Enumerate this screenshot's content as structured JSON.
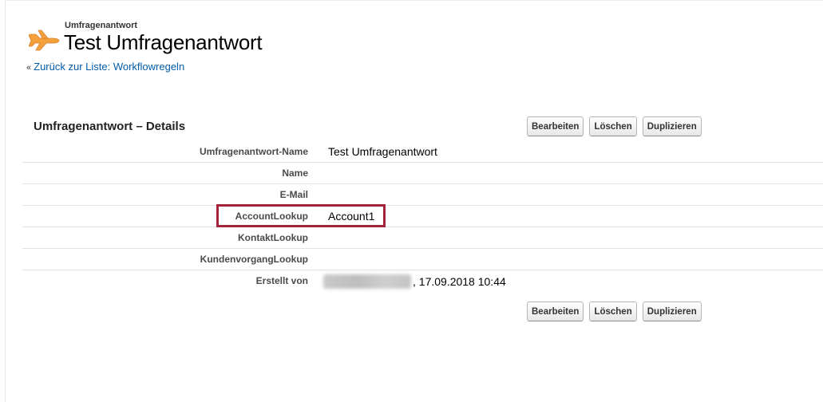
{
  "header": {
    "object_type": "Umfragenantwort",
    "title": "Test Umfragenantwort",
    "icon": "airplane-icon",
    "icon_color": "#f3a03d"
  },
  "back_link": {
    "arrow": "«",
    "label": "Zurück zur Liste: Workflowregeln",
    "color": "#015ba7"
  },
  "section": {
    "title": "Umfragenantwort – Details"
  },
  "buttons": {
    "edit": "Bearbeiten",
    "delete": "Löschen",
    "clone": "Duplizieren"
  },
  "fields": [
    {
      "label": "Umfragenantwort-Name",
      "value": "Test Umfragenantwort"
    },
    {
      "label": "Name",
      "value": ""
    },
    {
      "label": "E-Mail",
      "value": ""
    },
    {
      "label": "AccountLookup",
      "value": "Account1"
    },
    {
      "label": "KontaktLookup",
      "value": ""
    },
    {
      "label": "KundenvorgangLookup",
      "value": ""
    },
    {
      "label": "Erstellt von",
      "value": ", 17.09.2018 10:44"
    }
  ],
  "highlight_color": "#a3243a"
}
